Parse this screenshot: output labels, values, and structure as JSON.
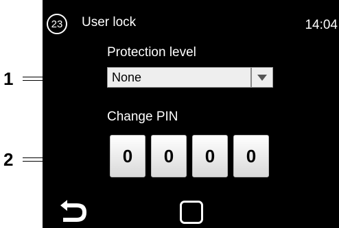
{
  "callouts": [
    "1",
    "2"
  ],
  "header": {
    "screen_number": "23",
    "title": "User lock",
    "time": "14:04"
  },
  "protection": {
    "label": "Protection level",
    "selected": "None"
  },
  "pin": {
    "label": "Change PIN",
    "digits": [
      "0",
      "0",
      "0",
      "0"
    ]
  },
  "nav": {
    "back_icon": "back-arrow-icon",
    "home_icon": "home-square-icon"
  }
}
